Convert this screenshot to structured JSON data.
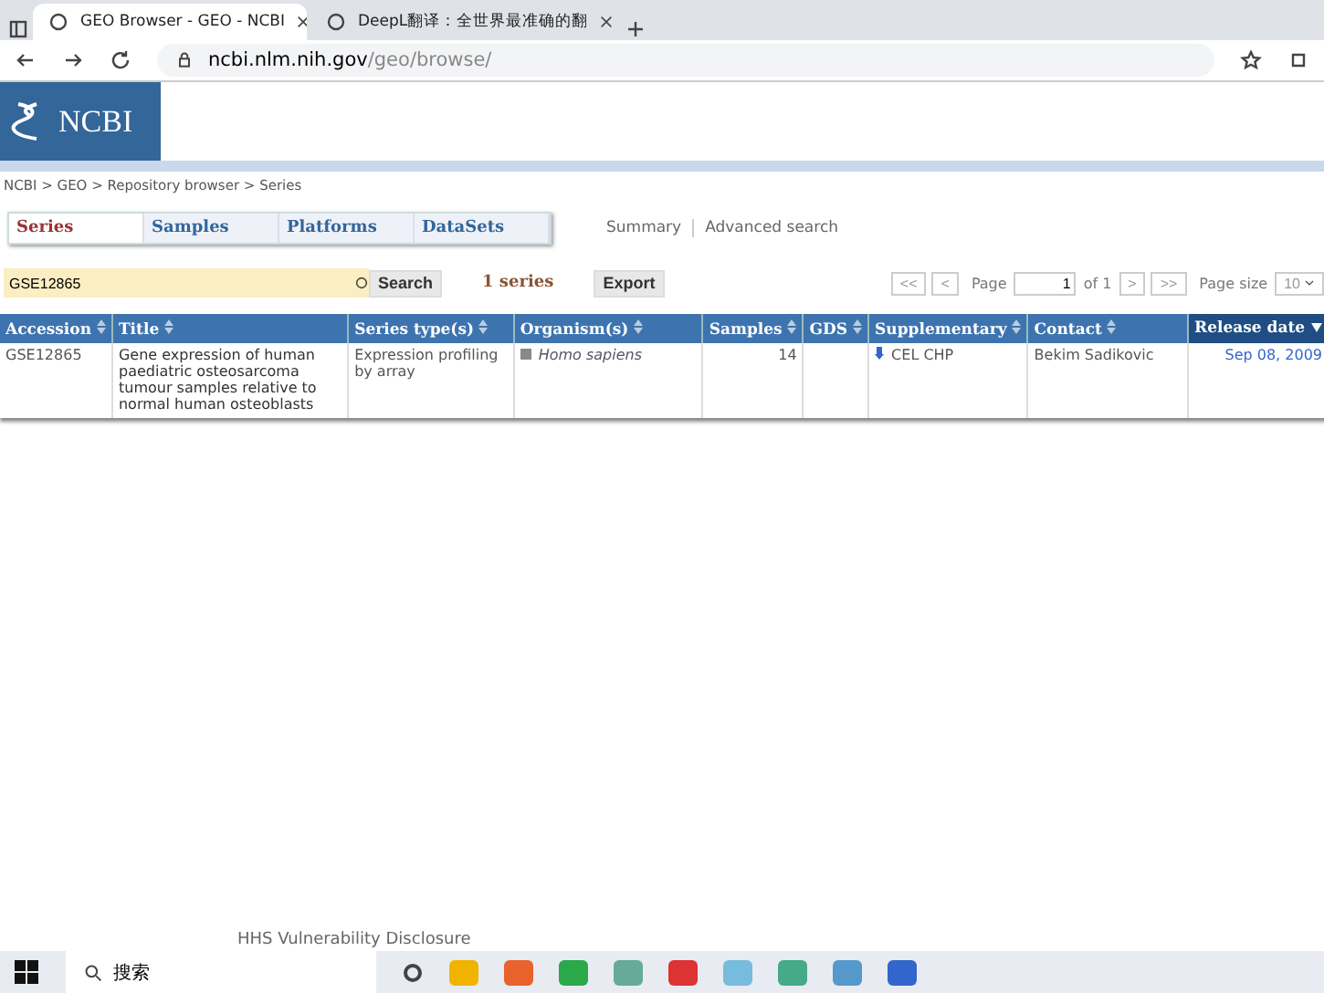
{
  "browser_tabs": [
    {
      "title": "GEO Browser - GEO - NCBI",
      "selected": true
    },
    {
      "title": "DeepL翻译：全世界最准确的翻",
      "selected": false
    }
  ],
  "address": {
    "host": "ncbi.nlm.nih.gov",
    "path": "/geo/browse/"
  },
  "logo": "NCBI",
  "breadcrumb": "NCBI > GEO > Repository browser > Series",
  "geo_tabs": [
    {
      "label": "Series",
      "selected": true
    },
    {
      "label": "Samples",
      "selected": false
    },
    {
      "label": "Platforms",
      "selected": false
    },
    {
      "label": "DataSets",
      "selected": false
    }
  ],
  "links": [
    "Summary",
    "Advanced search"
  ],
  "search": {
    "value": "GSE12865",
    "button": "Search"
  },
  "count": "1 series",
  "export": "Export",
  "pager": {
    "first": "<<",
    "prev": "<",
    "page_label": "Page",
    "page": "1",
    "of": "of 1",
    "next": ">",
    "last": ">>",
    "size_label": "Page size",
    "size": "10"
  },
  "table": {
    "columns": [
      {
        "label": "Accession",
        "sorted": false
      },
      {
        "label": "Title",
        "sorted": false
      },
      {
        "label": "Series type(s)",
        "sorted": false
      },
      {
        "label": "Organism(s)",
        "sorted": false
      },
      {
        "label": "Samples",
        "sorted": false
      },
      {
        "label": "GDS",
        "sorted": false
      },
      {
        "label": "Supplementary",
        "sorted": false
      },
      {
        "label": "Contact",
        "sorted": false
      },
      {
        "label": "Release date",
        "sorted": true
      }
    ],
    "rows": [
      {
        "accession": "GSE12865",
        "title": "Gene expression of human paediatric osteosarcoma tumour samples relative to normal human osteoblasts",
        "type": "Expression profiling by array",
        "organism": "Homo sapiens",
        "samples": "14",
        "gds": "",
        "supplementary": "CEL CHP",
        "contact": "Bekim Sadikovic",
        "release": "Sep 08, 2009"
      }
    ]
  },
  "footer": "HHS Vulnerability Disclosure",
  "taskbar": {
    "search": "搜索"
  }
}
